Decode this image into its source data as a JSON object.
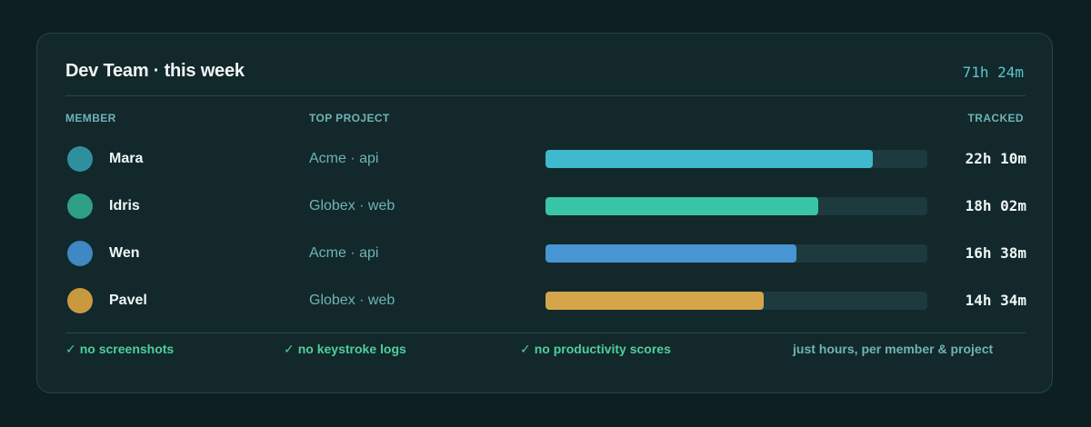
{
  "header": {
    "title": "Dev Team · this week",
    "total": "71h 24m"
  },
  "columns": {
    "member": "MEMBER",
    "project": "TOP PROJECT",
    "tracked": "TRACKED"
  },
  "members": [
    {
      "name": "Mara",
      "project": "Acme · api",
      "tracked": "22h 10m",
      "share": 0.857,
      "color": "#3fb9cd",
      "avatar_color": "#2f8f9f"
    },
    {
      "name": "Idris",
      "project": "Globex · web",
      "tracked": "18h 02m",
      "share": 0.714,
      "color": "#39c4a6",
      "avatar_color": "#2e9f87"
    },
    {
      "name": "Wen",
      "project": "Acme · api",
      "tracked": "16h 38m",
      "share": 0.657,
      "color": "#4795d3",
      "avatar_color": "#3f88c4"
    },
    {
      "name": "Pavel",
      "project": "Globex · web",
      "tracked": "14h 34m",
      "share": 0.571,
      "color": "#d4a54a",
      "avatar_color": "#c89a3f"
    }
  ],
  "footer": {
    "items": [
      {
        "icon": "check-icon",
        "label": "no screenshots"
      },
      {
        "icon": "check-icon",
        "label": "no keystroke logs"
      },
      {
        "icon": "check-icon",
        "label": "no productivity scores"
      }
    ],
    "note": "just hours, per member & project"
  }
}
